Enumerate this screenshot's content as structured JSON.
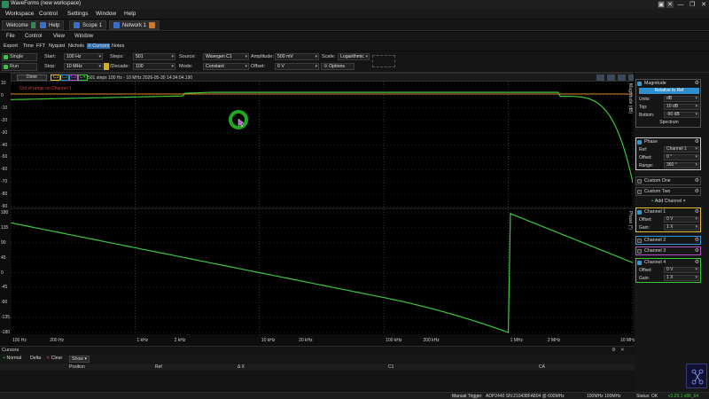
{
  "window": {
    "title": "WaveForms (new workspace)",
    "controls": [
      "▣",
      "✕",
      "—",
      "❐",
      "✕"
    ]
  },
  "menubar": {
    "items": [
      "Workspace",
      "Control",
      "Settings",
      "Window",
      "Help"
    ]
  },
  "tabs": [
    {
      "label": "Welcome",
      "color": "#2e8b57"
    },
    {
      "label": "Help",
      "color": "#3b6fc4"
    },
    {
      "label": "Scope 1",
      "color": "#3b6fc4"
    },
    {
      "label": "Network 1",
      "color": "#c9782f"
    }
  ],
  "submenu": {
    "items": [
      "File",
      "Control",
      "View",
      "Window"
    ]
  },
  "menu2": {
    "items": [
      "Export",
      "Time",
      "FFT",
      "Nyquist",
      "Nichols",
      "X Cursors",
      "Notes"
    ]
  },
  "controls": {
    "single_label": "Single",
    "run_label": "Run",
    "start_label": "Start:",
    "start_value": "100 Hz",
    "stop_label": "Stop:",
    "stop_value": "10 MHz",
    "steps_label": "Steps:",
    "steps_value": "501",
    "per_decade_label": "/Decade:",
    "per_decade_value": "100",
    "source_label": "Source:",
    "source_value": "Wavegen C1",
    "mode_label": "Mode:",
    "mode_value": "Constant",
    "amplitude_label": "Amplitude:",
    "amplitude_value": "500 mV",
    "offset_label": "Offset:",
    "offset_value": "0 V",
    "scale_label": "Scale:",
    "scale_value": "Logarithmic",
    "options_label": "Options"
  },
  "plot_header": {
    "status": "Done",
    "channels": [
      "C1",
      "C2",
      "C3",
      "C4"
    ],
    "info": "501 steps  100 Hz - 10 MHz  2026-05-30 14:34:04.190",
    "warning": "Out of range on Channel 1"
  },
  "magnitude": {
    "axis_name": "Magnitude (dB)",
    "y_ticks": [
      "10",
      "0",
      "-10",
      "-20",
      "-30",
      "-40",
      "-50",
      "-60",
      "-70",
      "-80",
      "-90"
    ]
  },
  "phase": {
    "axis_name": "Phase (°)",
    "y_ticks": [
      "180",
      "135",
      "90",
      "45",
      "0",
      "-45",
      "-90",
      "-135",
      "-180"
    ]
  },
  "x_ticks": [
    "100 Hz",
    "200 Hz",
    "1 kHz",
    "2 kHz",
    "10 kHz",
    "20 kHz",
    "100 kHz",
    "200 kHz",
    "1 MHz",
    "2 MHz",
    "10 MHz"
  ],
  "right_panel": {
    "magnitude": {
      "title": "Magnitude",
      "relative_btn": "Relative to Ref",
      "units_label": "Units:",
      "units_value": "dB",
      "top_label": "Top:",
      "top_value": "10 dB",
      "bottom_label": "Bottom:",
      "bottom_value": "-90 dB",
      "spectrum_label": "Spectrum"
    },
    "phase": {
      "title": "Phase",
      "ref_label": "Ref:",
      "ref_value": "Channel 1",
      "offset_label": "Offset:",
      "offset_value": "0 °",
      "range_label": "Range:",
      "range_value": "360 °"
    },
    "custom_one": "Custom One",
    "custom_two": "Custom Two",
    "add_channel": "Add Channel",
    "channel1": {
      "title": "Channel 1",
      "offset_label": "Offset:",
      "offset_value": "0 V",
      "gain_label": "Gain:",
      "gain_value": "1 X"
    },
    "channel2": "Channel 2",
    "channel3": "Channel 3",
    "channel4": {
      "title": "Channel 4",
      "offset_label": "Offset:",
      "offset_value": "0 V",
      "gain_label": "Gain:",
      "gain_value": "1 X"
    }
  },
  "cursors": {
    "title": "Cursors",
    "normal": "Normal",
    "delta": "Delta",
    "clear": "Clear",
    "show": "Show",
    "columns": [
      "Position",
      "Ref",
      "Δ X",
      "C1",
      "CA"
    ]
  },
  "statusbar": {
    "manual_trigger": "Manual Trigger",
    "device": "ADP2440 SN:210438FA804 @ 600MHz",
    "clock": "100MHz 100MHz",
    "status": "Status: OK",
    "version": "v3.25.1 x86_64"
  },
  "colors": {
    "trace": "#3cc83c",
    "ref_trace": "#e08a2a",
    "channel1": "#e8c030",
    "channel2": "#2e9bd6",
    "channel3": "#b44fc8",
    "channel4": "#3cc83c"
  }
}
